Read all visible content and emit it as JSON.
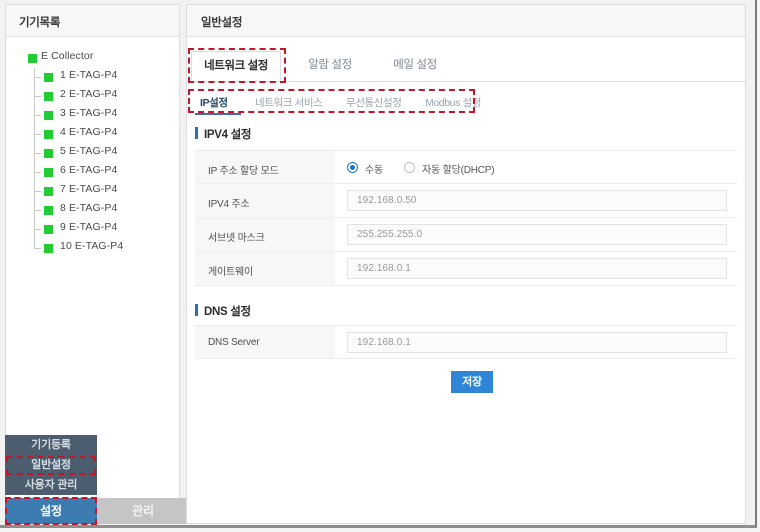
{
  "left_panel": {
    "title": "기기목록",
    "tree": {
      "root": {
        "label": "E Collector",
        "status_color": "#22cc33"
      },
      "children": [
        {
          "label": "1 E-TAG-P4",
          "status_color": "#22cc33"
        },
        {
          "label": "2 E-TAG-P4",
          "status_color": "#22cc33"
        },
        {
          "label": "3 E-TAG-P4",
          "status_color": "#22cc33"
        },
        {
          "label": "4 E-TAG-P4",
          "status_color": "#22cc33"
        },
        {
          "label": "5 E-TAG-P4",
          "status_color": "#22cc33"
        },
        {
          "label": "6 E-TAG-P4",
          "status_color": "#22cc33"
        },
        {
          "label": "7 E-TAG-P4",
          "status_color": "#22cc33"
        },
        {
          "label": "8 E-TAG-P4",
          "status_color": "#22cc33"
        },
        {
          "label": "9 E-TAG-P4",
          "status_color": "#22cc33"
        },
        {
          "label": "10 E-TAG-P4",
          "status_color": "#22cc33"
        }
      ]
    }
  },
  "nav": {
    "stack_items": [
      {
        "label": "기기등록",
        "highlighted": false
      },
      {
        "label": "일반설정",
        "highlighted": true
      },
      {
        "label": "사용자 관리",
        "highlighted": false
      }
    ],
    "tabs": [
      {
        "label": "설정",
        "active": true
      },
      {
        "label": "관리",
        "active": false
      }
    ],
    "active_color": "#3d7cb0",
    "inactive_color": "#c5c5c5",
    "stack_bg": "#4b5d6e"
  },
  "right_panel": {
    "title": "일반설정",
    "main_tabs": [
      {
        "label": "네트워크 설정",
        "active": true
      },
      {
        "label": "알람 설정",
        "active": false
      },
      {
        "label": "메일 설정",
        "active": false
      }
    ],
    "sub_tabs": [
      {
        "label": "IP설정",
        "active": true
      },
      {
        "label": "네트워크 서비스",
        "active": false
      },
      {
        "label": "무선통신설정",
        "active": false
      },
      {
        "label": "Modbus 설정",
        "active": false
      }
    ],
    "sections": [
      {
        "title": "IPV4 설정",
        "rows": [
          {
            "label": "IP 주소 할당 모드",
            "type": "radio",
            "options": [
              {
                "label": "수동",
                "selected": true
              },
              {
                "label": "자동 할당(DHCP)",
                "selected": false
              }
            ]
          },
          {
            "label": "IPV4 주소",
            "type": "text",
            "value": "192.168.0.50"
          },
          {
            "label": "서브넷 마스크",
            "type": "text",
            "value": "255.255.255.0"
          },
          {
            "label": "게이트웨이",
            "type": "text",
            "value": "192.168.0.1"
          }
        ]
      },
      {
        "title": "DNS 설정",
        "rows": [
          {
            "label": "DNS Server",
            "type": "text",
            "value": "192.168.0.1"
          }
        ]
      }
    ],
    "save_button": "저장",
    "accent_color": "#2f86d6"
  },
  "annotation_color": "#c4152c"
}
